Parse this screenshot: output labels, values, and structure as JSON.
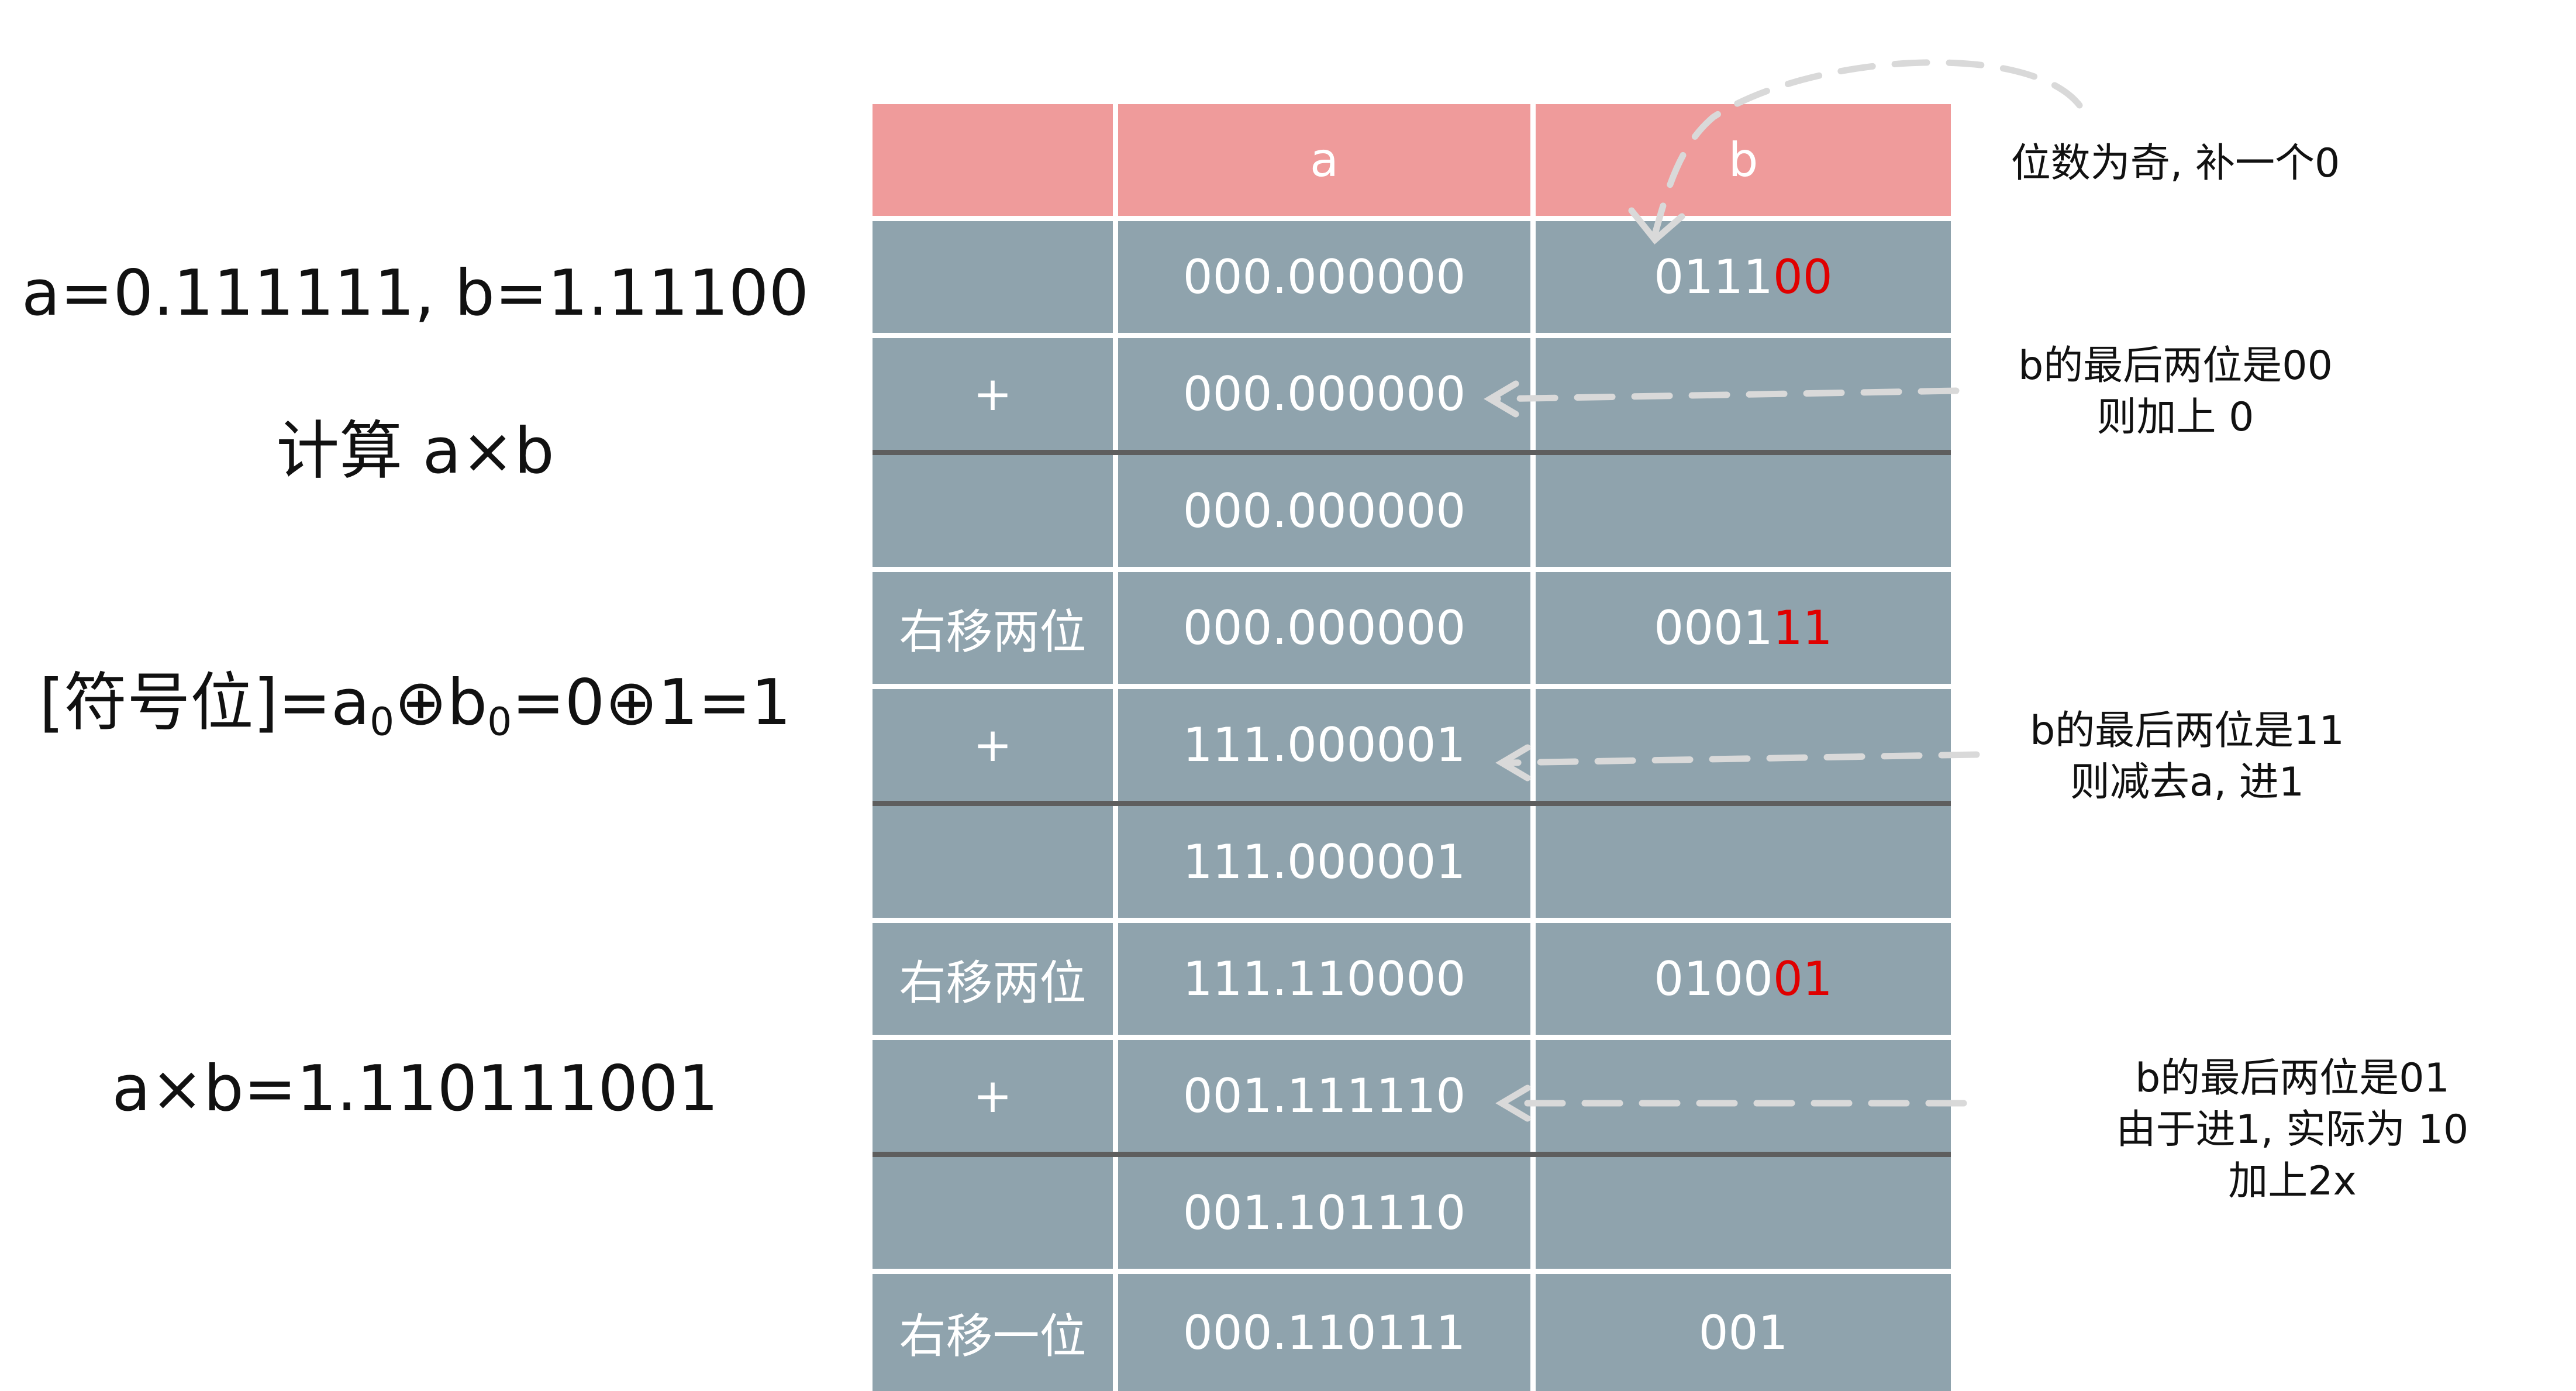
{
  "left": {
    "given": "a=0.111111, b=1.11100",
    "task": "计算 a×b",
    "sign": {
      "prefix": "[符号位]=a",
      "sub1": "0",
      "mid": "⊕b",
      "sub2": "0",
      "suffix": "=0⊕1=1"
    },
    "result": "a×b=1.110111001"
  },
  "table": {
    "headers": [
      "",
      "a",
      "b"
    ],
    "rows": [
      {
        "op": "",
        "a": "000.000000",
        "b": "0111",
        "b_hl": "00",
        "sum": false
      },
      {
        "op": "+",
        "a": "000.000000",
        "b": "",
        "b_hl": "",
        "sum": true
      },
      {
        "op": "",
        "a": "000.000000",
        "b": "",
        "b_hl": "",
        "sum": false
      },
      {
        "op": "右移两位",
        "a": "000.000000",
        "b": "0001",
        "b_hl": "11",
        "sum": false
      },
      {
        "op": "+",
        "a": "111.000001",
        "b": "",
        "b_hl": "",
        "sum": true
      },
      {
        "op": "",
        "a": "111.000001",
        "b": "",
        "b_hl": "",
        "sum": false
      },
      {
        "op": "右移两位",
        "a": "111.110000",
        "b": "0100",
        "b_hl": "01",
        "sum": false
      },
      {
        "op": "+",
        "a": "001.111110",
        "b": "",
        "b_hl": "",
        "sum": true
      },
      {
        "op": "",
        "a": "001.101110",
        "b": "",
        "b_hl": "",
        "sum": false
      },
      {
        "op": "右移一位",
        "a": "000.110111",
        "b": "001",
        "b_hl": "",
        "sum": false
      }
    ]
  },
  "notes": {
    "n1": {
      "line1": "位数为奇, 补一个0"
    },
    "n2": {
      "line1": "b的最后两位是00",
      "line2": "则加上 0"
    },
    "n3": {
      "line1": "b的最后两位是11",
      "line2": "则减去a, 进1"
    },
    "n4": {
      "line1": "b的最后两位是01",
      "line2": "由于进1, 实际为 10",
      "line3": "加上2x"
    }
  },
  "colors": {
    "header": "#ef9b9b",
    "cell": "#8fa3ad",
    "highlight": "#e00000",
    "arrow": "#d9d9d9"
  }
}
